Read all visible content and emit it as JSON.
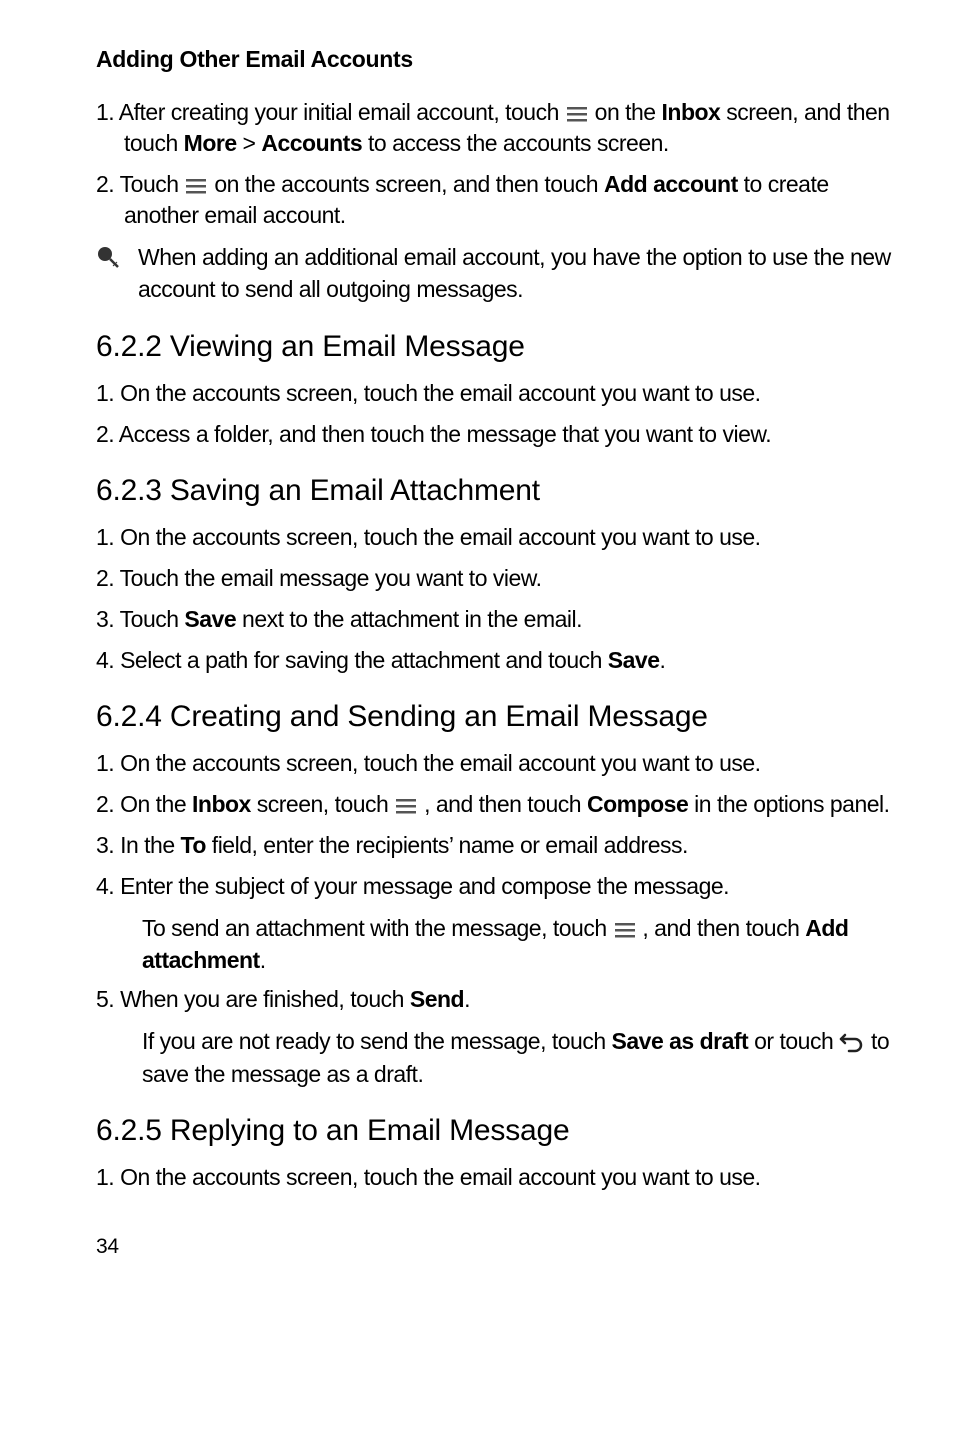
{
  "heading_sub": "Adding Other Email Accounts",
  "step_a1_pre": "1. After creating your initial email account, touch ",
  "step_a1_mid": " on the ",
  "step_a1_b1": "Inbox",
  "step_a1_mid2": " screen, and then touch ",
  "step_a1_b2": "More",
  "step_a1_gt": " > ",
  "step_a1_b3": "Accounts",
  "step_a1_post": " to access the accounts screen.",
  "step_a2_pre": "2. Touch ",
  "step_a2_mid": " on the accounts screen, and then touch ",
  "step_a2_b1": "Add account",
  "step_a2_post": " to create another email account.",
  "note1": "When adding an additional email account, you have the option to use the new account to send all outgoing messages.",
  "sec622": "6.2.2  Viewing an Email Message",
  "s622_1": "1. On the accounts screen, touch the email account you want to use.",
  "s622_2": "2. Access a folder, and then touch the message that you want to view.",
  "sec623": "6.2.3  Saving an Email Attachment",
  "s623_1": "1. On the accounts screen, touch the email account you want to use.",
  "s623_2": "2. Touch the email message you want to view.",
  "s623_3_pre": "3. Touch ",
  "s623_3_b": "Save",
  "s623_3_post": " next to the attachment in the email.",
  "s623_4_pre": "4. Select a path for saving the attachment and touch ",
  "s623_4_b": "Save",
  "s623_4_post": ".",
  "sec624": "6.2.4  Creating and Sending an Email Message",
  "s624_1": "1. On the accounts screen, touch the email account you want to use.",
  "s624_2_pre": "2. On the ",
  "s624_2_b1": "Inbox",
  "s624_2_mid": " screen, touch ",
  "s624_2_mid2": " , and then touch ",
  "s624_2_b2": "Compose",
  "s624_2_post": " in the options panel.",
  "s624_3_pre": "3. In the ",
  "s624_3_b": "To",
  "s624_3_post": " field, enter the recipients’ name or email address.",
  "s624_4": "4. Enter the subject of your message and compose the message.",
  "s624_attach_pre": "To send an attachment with the message, touch ",
  "s624_attach_mid": " , and then touch ",
  "s624_attach_b": "Add attachment",
  "s624_attach_post": ".",
  "s624_5_pre": "5. When you are finished, touch ",
  "s624_5_b": "Send",
  "s624_5_post": ".",
  "s624_draft_pre": "If you are not ready to send the message, touch ",
  "s624_draft_b": "Save as draft",
  "s624_draft_mid": " or touch ",
  "s624_draft_post": " to save the message as a draft.",
  "sec625": "6.2.5  Replying to an Email Message",
  "s625_1": "1. On the accounts screen, touch the email account you want to use.",
  "page_number": "34"
}
